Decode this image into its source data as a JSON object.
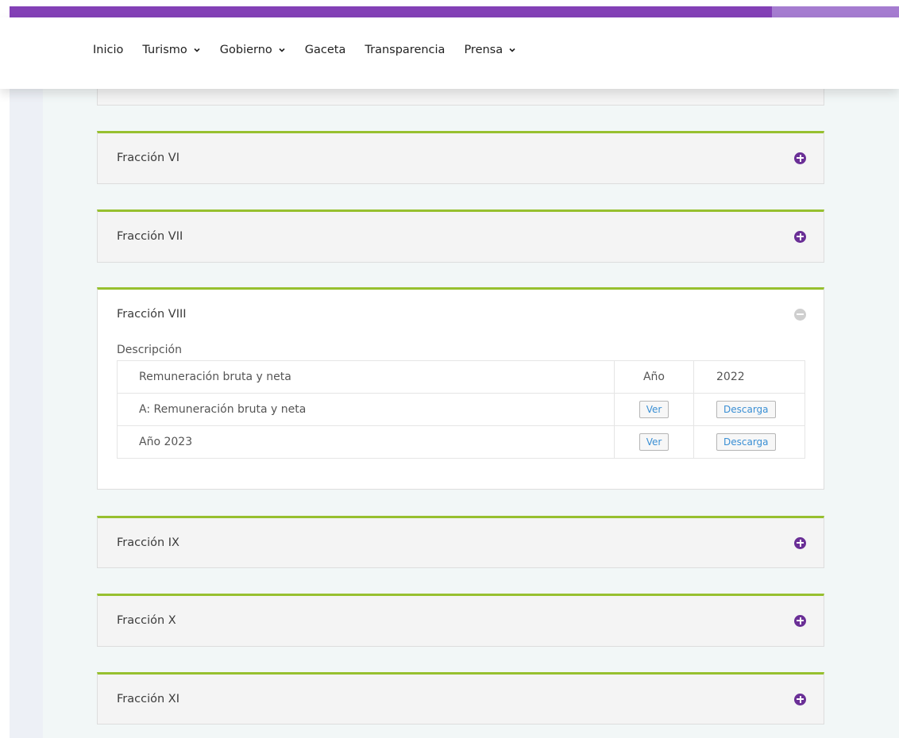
{
  "nav": {
    "items": [
      {
        "label": "Inicio",
        "dropdown": false
      },
      {
        "label": "Turismo",
        "dropdown": true
      },
      {
        "label": "Gobierno",
        "dropdown": true
      },
      {
        "label": "Gaceta",
        "dropdown": false
      },
      {
        "label": "Transparencia",
        "dropdown": false
      },
      {
        "label": "Prensa",
        "dropdown": true
      }
    ]
  },
  "colors": {
    "brand_purple": "#8340b6",
    "brand_purple_light": "#a57cd0",
    "accent_green": "#97c02f",
    "toggle_purple": "#6a2f96",
    "link_blue": "#3a8fd4"
  },
  "accordion": {
    "panels": [
      {
        "title": "Fracción VI",
        "state": "collapsed",
        "toggle_icon": "plus-circle-icon"
      },
      {
        "title": "Fracción VII",
        "state": "collapsed",
        "toggle_icon": "plus-circle-icon"
      },
      {
        "title": "Fracción VIII",
        "state": "expanded",
        "toggle_icon": "minus-circle-icon"
      },
      {
        "title": "Fracción IX",
        "state": "collapsed",
        "toggle_icon": "plus-circle-icon"
      },
      {
        "title": "Fracción X",
        "state": "collapsed",
        "toggle_icon": "plus-circle-icon"
      },
      {
        "title": "Fracción XI",
        "state": "collapsed",
        "toggle_icon": "plus-circle-icon"
      }
    ],
    "open_panel": {
      "description_label": "Descripción",
      "rows": [
        {
          "name": "Remuneración bruta y neta",
          "col2": "Año",
          "col3": "2022"
        },
        {
          "name": "A: Remuneración bruta y neta",
          "view_label": "Ver",
          "download_label": "Descarga"
        },
        {
          "name": "Año 2023",
          "view_label": "Ver",
          "download_label": "Descarga"
        }
      ]
    }
  }
}
